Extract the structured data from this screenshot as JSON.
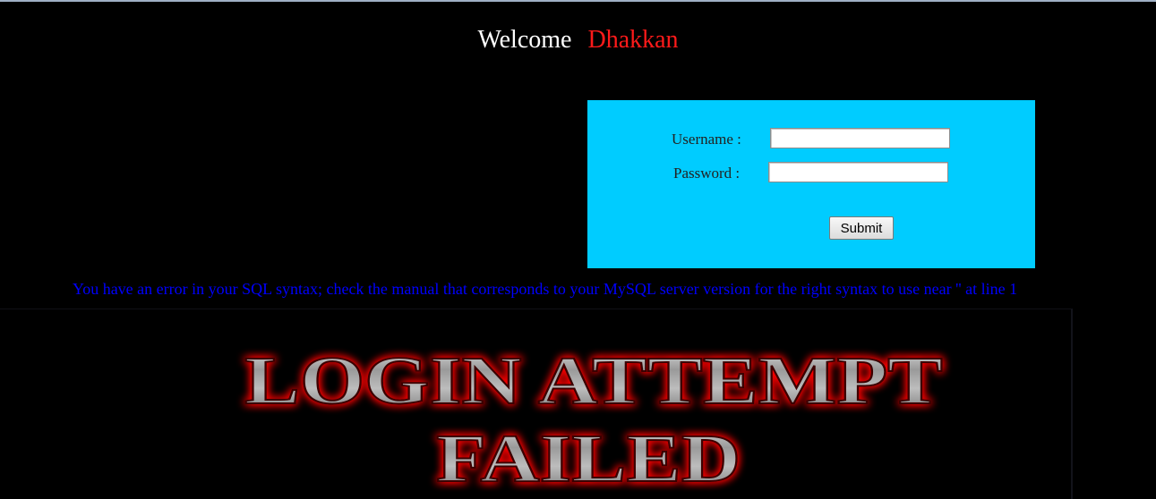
{
  "header": {
    "welcome": "Welcome",
    "name": "Dhakkan"
  },
  "login_form": {
    "username_label": "Username :",
    "password_label": "Password :",
    "username_value": "",
    "password_value": "",
    "submit_label": "Submit",
    "background_color": "#00ccff"
  },
  "error": {
    "message": "You have an error in your SQL syntax; check the manual that corresponds to your MySQL server version for the right syntax to use near '' at line 1",
    "color": "#0000ff"
  },
  "banner": {
    "line1": "LOGIN ATTEMPT",
    "line2": "FAILED",
    "glow_color": "#ff0000"
  }
}
